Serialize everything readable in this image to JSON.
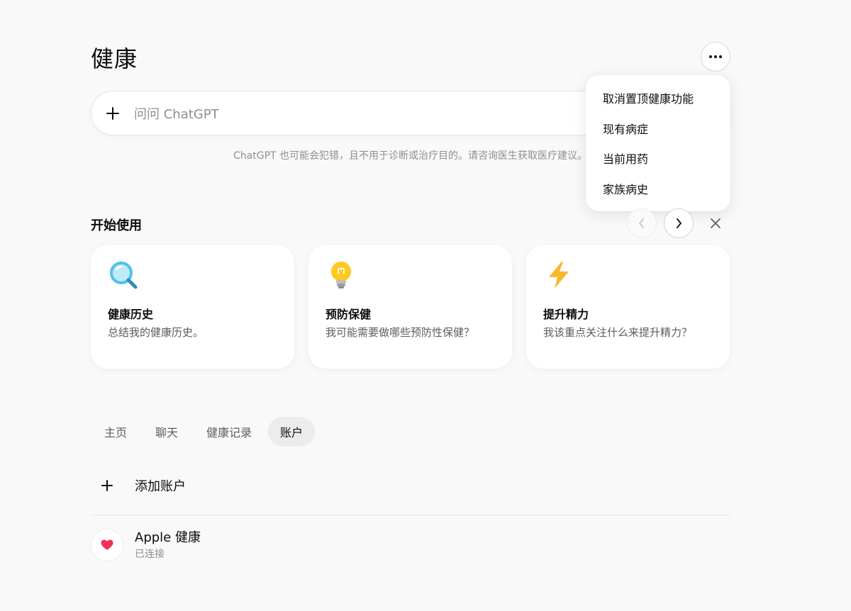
{
  "page": {
    "title": "健康"
  },
  "composer": {
    "placeholder": "问问 ChatGPT"
  },
  "disclaimer": "ChatGPT 也可能会犯错，且不用于诊断或治疗目的。请咨询医生获取医疗建议。",
  "menu": {
    "items": [
      {
        "label": "取消置顶健康功能"
      },
      {
        "label": "现有病症"
      },
      {
        "label": "当前用药"
      },
      {
        "label": "家族病史"
      }
    ]
  },
  "getting_started": {
    "title": "开始使用",
    "cards": [
      {
        "icon": "magnifier-icon",
        "title": "健康历史",
        "subtitle": "总结我的健康历史。"
      },
      {
        "icon": "lightbulb-icon",
        "title": "预防保健",
        "subtitle": "我可能需要做哪些预防性保健？"
      },
      {
        "icon": "lightning-icon",
        "title": "提升精力",
        "subtitle": "我该重点关注什么来提升精力？"
      }
    ]
  },
  "tabs": [
    {
      "label": "主页",
      "active": false
    },
    {
      "label": "聊天",
      "active": false
    },
    {
      "label": "健康记录",
      "active": false
    },
    {
      "label": "账户",
      "active": true
    }
  ],
  "accounts": {
    "add_label": "添加账户",
    "items": [
      {
        "name": "Apple 健康",
        "status": "已连接",
        "icon": "heart-icon"
      }
    ]
  },
  "colors": {
    "background": "#f9f9f9",
    "heart": "#f0305a",
    "bulb": "#ffc81e",
    "lightning": "#f9b72a",
    "magnifier": "#4fc3e8"
  }
}
